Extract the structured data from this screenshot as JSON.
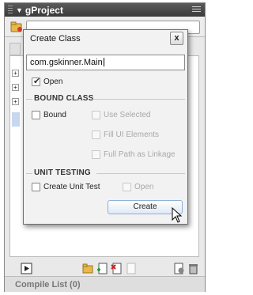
{
  "panel": {
    "title": "gProject",
    "compile_list_label": "Compile List (0)"
  },
  "dialog": {
    "title": "Create Class",
    "close_label": "x",
    "class_name_value": "com.gskinner.Main",
    "open_label": "Open",
    "open_checked": true,
    "bound_class": {
      "section_label": "BOUND CLASS",
      "bound_label": "Bound",
      "bound_checked": false,
      "use_selected_label": "Use Selected",
      "fill_ui_elements_label": "Fill UI Elements",
      "full_path_label": "Full Path as Linkage"
    },
    "unit_testing": {
      "section_label": "UNIT TESTING",
      "create_unit_test_label": "Create Unit Test",
      "open_label": "Open"
    },
    "create_label": "Create"
  },
  "colors": {
    "titlebar": "#4a4a4a",
    "dialog_bg": "#f2f2f2",
    "button_border": "#8fb0d8",
    "selection": "#c6d7ef"
  }
}
